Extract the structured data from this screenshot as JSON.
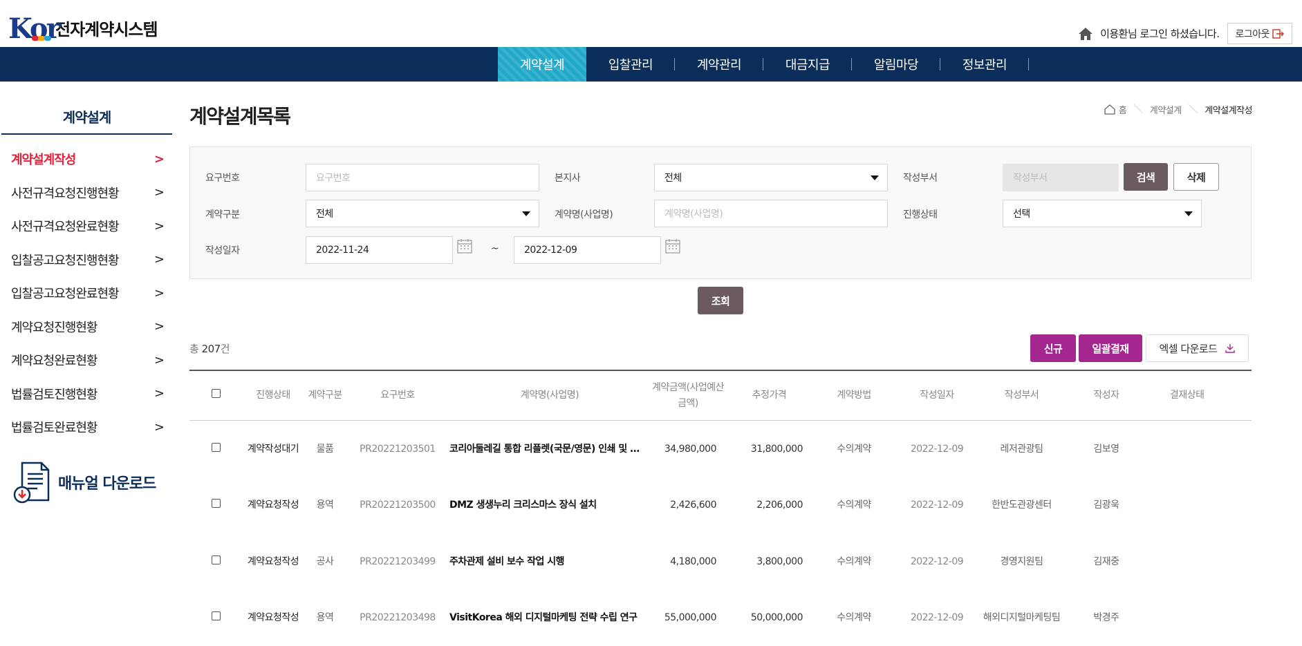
{
  "header": {
    "logo_mark": "Kor",
    "logo_text": "전자계약시스템",
    "user_text": "이용환님 로그인 하셨습니다.",
    "logout_label": "로그아웃"
  },
  "gnb": {
    "items": [
      "계약설계",
      "입찰관리",
      "계약관리",
      "대금지급",
      "알림마당",
      "정보관리"
    ],
    "active_index": 0
  },
  "sidebar": {
    "title": "계약설계",
    "items": [
      {
        "label": "계약설계작성",
        "arrow": ">"
      },
      {
        "label": "사전규격요청진행현황",
        "arrow": ">"
      },
      {
        "label": "사전규격요청완료현황",
        "arrow": ">"
      },
      {
        "label": "입찰공고요청진행현황",
        "arrow": ">"
      },
      {
        "label": "입찰공고요청완료현황",
        "arrow": ">"
      },
      {
        "label": "계약요청진행현황",
        "arrow": ">"
      },
      {
        "label": "계약요청완료현황",
        "arrow": ">"
      },
      {
        "label": "법률검토진행현황",
        "arrow": ">"
      },
      {
        "label": "법률검토완료현황",
        "arrow": ">"
      }
    ],
    "active_index": 0,
    "manual_label": "매뉴얼 다운로드"
  },
  "page": {
    "title": "계약설계목록",
    "breadcrumb": [
      "홈",
      "계약설계",
      "계약설계작성"
    ]
  },
  "search": {
    "req_no_label": "요구번호",
    "req_no_placeholder": "요구번호",
    "branch_label": "본지사",
    "branch_value": "전체",
    "dept_label": "작성부서",
    "dept_placeholder": "작성부서",
    "search_btn": "검색",
    "delete_btn": "삭제",
    "type_label": "계약구분",
    "type_value": "전체",
    "name_label": "계약명(사업명)",
    "name_placeholder": "계약명(사업명)",
    "status_label": "진행상태",
    "status_value": "선택",
    "date_label": "작성일자",
    "date_from": "2022-11-24",
    "date_sep": "~",
    "date_to": "2022-12-09",
    "query_btn": "조회"
  },
  "list": {
    "total_prefix": "총",
    "total_count": "207",
    "total_suffix": "건",
    "new_btn": "신규",
    "batch_btn": "일괄결재",
    "excel_btn": "엑셀 다운로드",
    "headers": {
      "status": "진행상태",
      "type": "계약구분",
      "id": "요구번호",
      "name": "계약명(사업명)",
      "amount": "계약금액(사업예산금액)",
      "estimate": "추정가격",
      "method": "계약방법",
      "date": "작성일자",
      "dept": "작성부서",
      "author": "작성자",
      "approval": "결재상태"
    },
    "rows": [
      {
        "status": "계약작성대기",
        "type": "물품",
        "id": "PR20221203501",
        "name": "코리아둘레길 통합 리플렛(국문/영문) 인쇄 및 배포",
        "amount": "34,980,000",
        "estimate": "31,800,000",
        "method": "수의계약",
        "date": "2022-12-09",
        "dept": "레저관광팀",
        "author": "김보영",
        "approval": ""
      },
      {
        "status": "계약요청작성",
        "type": "용역",
        "id": "PR20221203500",
        "name": "DMZ 생생누리 크리스마스 장식 설치",
        "amount": "2,426,600",
        "estimate": "2,206,000",
        "method": "수의계약",
        "date": "2022-12-09",
        "dept": "한반도관광센터",
        "author": "김광욱",
        "approval": ""
      },
      {
        "status": "계약요청작성",
        "type": "공사",
        "id": "PR20221203499",
        "name": "주차관제 설비 보수 작업 시행",
        "amount": "4,180,000",
        "estimate": "3,800,000",
        "method": "수의계약",
        "date": "2022-12-09",
        "dept": "경영지원팀",
        "author": "김재중",
        "approval": ""
      },
      {
        "status": "계약요청작성",
        "type": "용역",
        "id": "PR20221203498",
        "name": "VisitKorea 해외 디지털마케팅 전략 수립 연구",
        "amount": "55,000,000",
        "estimate": "50,000,000",
        "method": "수의계약",
        "date": "2022-12-09",
        "dept": "해외디지털마케팅팀",
        "author": "박경주",
        "approval": ""
      }
    ]
  }
}
